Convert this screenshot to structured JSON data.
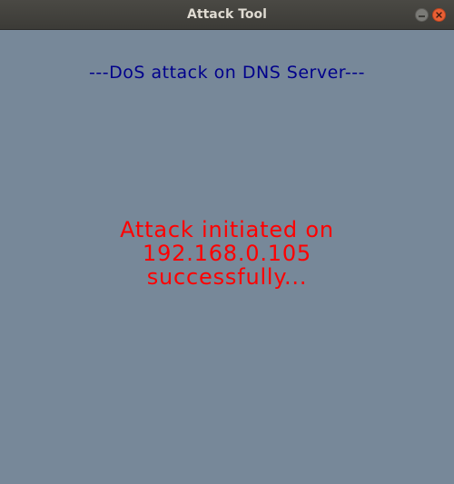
{
  "window": {
    "title": "Attack Tool"
  },
  "main": {
    "heading": "---DoS attack on DNS Server---",
    "status_lines": [
      "Attack initiated on",
      "192.168.0.105",
      "successfully..."
    ]
  },
  "colors": {
    "background": "#778899",
    "heading": "#00008b",
    "status": "#ff0000",
    "close_button": "#e95f34"
  },
  "icons": {
    "minimize": "minimize-icon",
    "close": "close-icon"
  }
}
